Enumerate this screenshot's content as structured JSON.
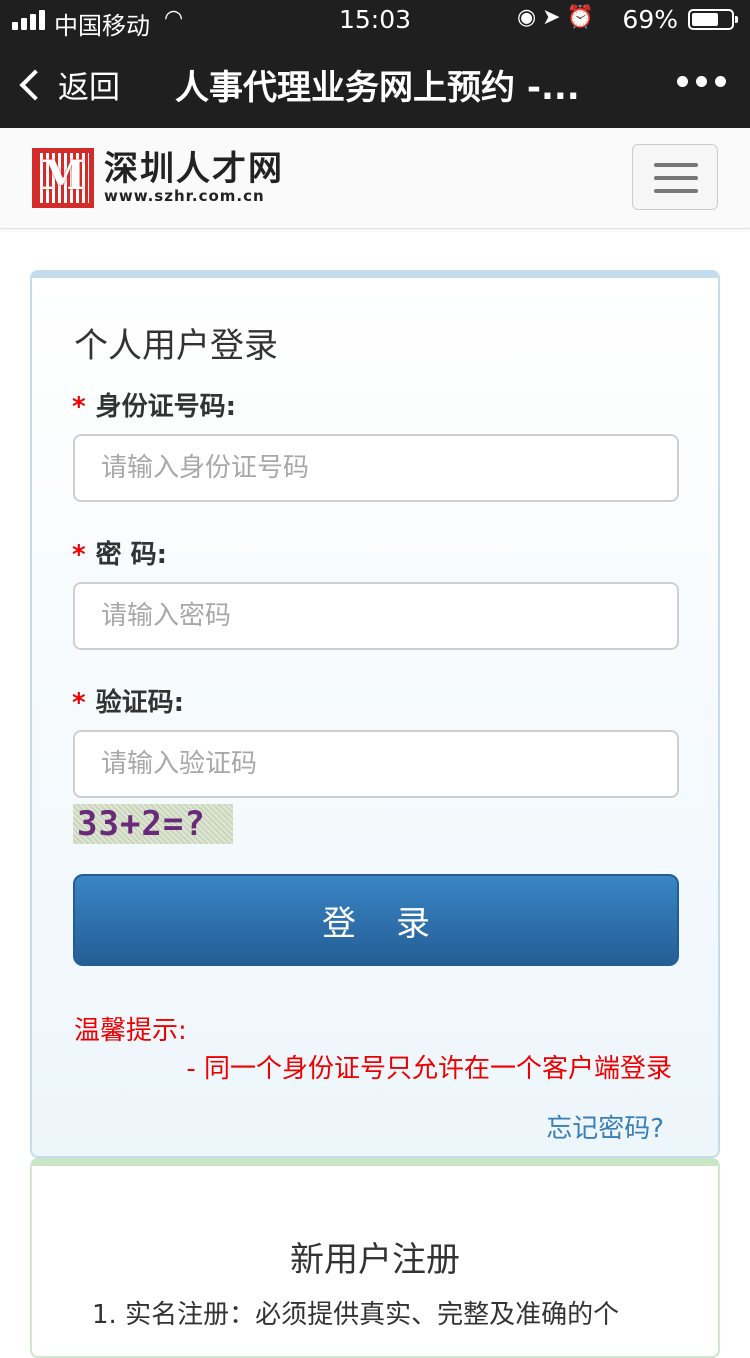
{
  "status_bar": {
    "carrier": "中国移动",
    "time": "15:03",
    "battery": "69%",
    "battery_level": 0.69
  },
  "nav": {
    "back_label": "返回",
    "title": "人事代理业务网上预约 -..."
  },
  "header": {
    "logo_name": "深圳人才网",
    "logo_url": "www.szhr.com.cn"
  },
  "login": {
    "title": "个人用户登录",
    "required_mark": "*",
    "id_label": "身份证号码:",
    "id_placeholder": "请输入身份证号码",
    "password_label": "密 码:",
    "password_placeholder": "请输入密码",
    "captcha_label": "验证码:",
    "captcha_placeholder": "请输入验证码",
    "captcha_text": "33+2=?",
    "submit_label": "登录",
    "tip_title": "温馨提示:",
    "tip_line": "- 同一个身份证号只允许在一个客户端登录",
    "forgot_label": "忘记密码?"
  },
  "register": {
    "title": "新用户注册",
    "item1": "1.  实名注册：必须提供真实、完整及准确的个"
  },
  "colors": {
    "topbar": "#1f1f1f",
    "primary_button": "#2f70ad",
    "warning_text": "#e00000",
    "link": "#3a7fb8",
    "logo_red": "#d32a2a"
  }
}
